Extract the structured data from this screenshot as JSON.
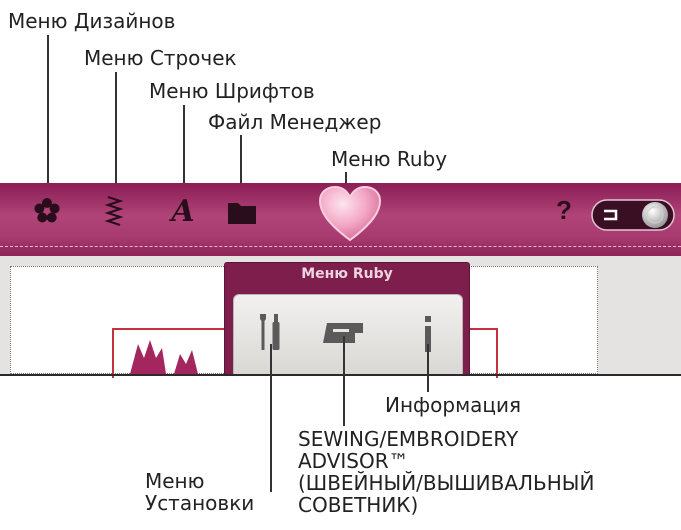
{
  "callouts": {
    "designs_menu": "Меню Дизайнов",
    "stitch_menu": "Меню Строчек",
    "font_menu": "Меню Шрифтов",
    "file_manager": "Файл Менеджер",
    "ruby_menu": "Меню Ruby",
    "info": "Информация",
    "advisor_line1": "SEWING/EMBROIDERY",
    "advisor_line2": "ADVISOR™",
    "advisor_line3": "(ШВЕЙНЫЙ/ВЫШИВАЛЬНЫЙ",
    "advisor_line4": "СОВЕТНИК)",
    "settings_line1": "Меню",
    "settings_line2": "Установки"
  },
  "toolbar": {
    "help_glyph": "?",
    "font_glyph": "A",
    "icons": [
      "flower-icon",
      "stitch-icon",
      "font-icon",
      "folder-icon",
      "heart-icon",
      "help-icon",
      "toggle-switch"
    ]
  },
  "popup": {
    "title": "Меню Ruby",
    "items": [
      "settings-icon",
      "advisor-icon",
      "info-icon"
    ]
  },
  "colors": {
    "toolbar_top": "#8a1e55",
    "toolbar_mid": "#b04478",
    "heart": "#f4a9c6",
    "popup_bg": "#7e1e4d",
    "frame_red": "#c5323c"
  }
}
